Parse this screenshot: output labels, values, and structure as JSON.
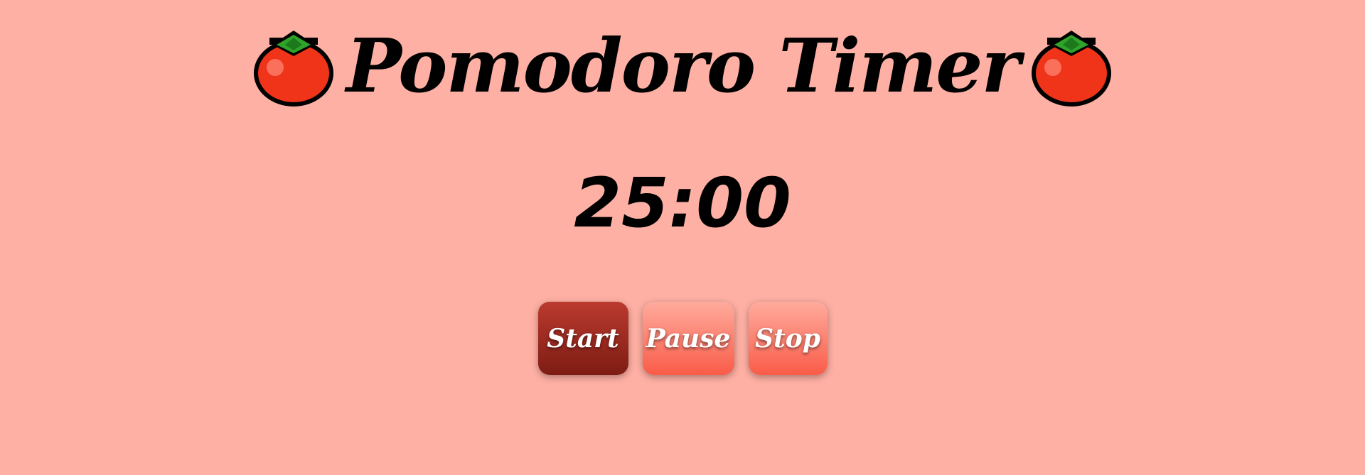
{
  "app": {
    "title": "Pomodoro Timer",
    "background_color": "#ffb0a4"
  },
  "header": {
    "left_icon": "tomato-icon",
    "right_icon": "tomato-icon"
  },
  "timer": {
    "display": "25:00"
  },
  "controls": {
    "start_label": "Start",
    "pause_label": "Pause",
    "stop_label": "Stop",
    "start_color": "#8f2419",
    "secondary_color": "#fb6e5b"
  }
}
